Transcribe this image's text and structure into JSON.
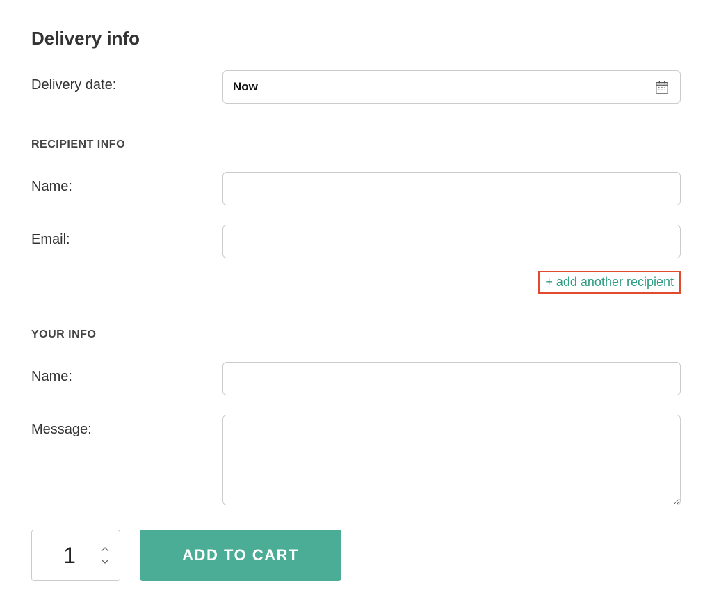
{
  "section": {
    "title": "Delivery info"
  },
  "delivery": {
    "date_label": "Delivery date:",
    "date_value": "Now"
  },
  "recipient": {
    "heading": "RECIPIENT INFO",
    "name_label": "Name:",
    "email_label": "Email:",
    "add_another": "+ add another recipient"
  },
  "your": {
    "heading": "YOUR INFO",
    "name_label": "Name:",
    "message_label": "Message:"
  },
  "cart": {
    "quantity": "1",
    "button": "ADD TO CART"
  }
}
